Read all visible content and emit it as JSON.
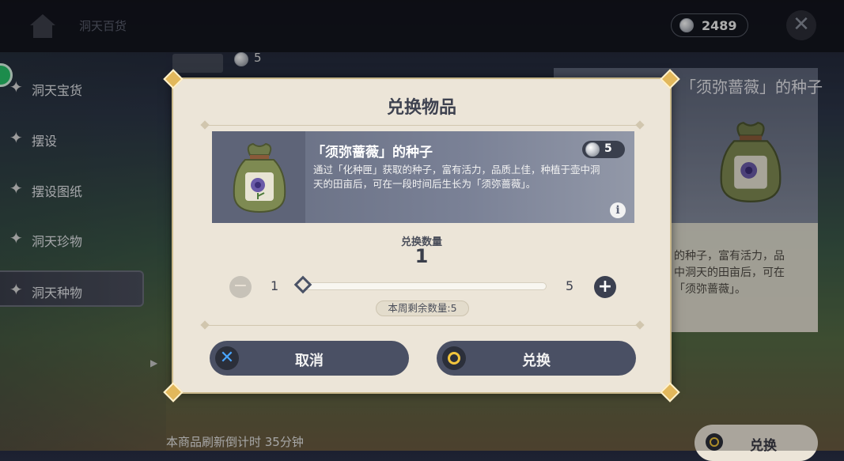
{
  "topbar": {
    "title": "洞天百货",
    "currency_value": "2489",
    "coin_icon": "mora-coin-icon",
    "close_icon": "close-icon"
  },
  "sidebar": {
    "items": [
      {
        "label": "洞天宝货",
        "active": false
      },
      {
        "label": "摆设",
        "active": false
      },
      {
        "label": "摆设图纸",
        "active": false
      },
      {
        "label": "洞天珍物",
        "active": false
      },
      {
        "label": "洞天种物",
        "active": true
      }
    ]
  },
  "background": {
    "list_item_price": "5",
    "detail_title": "「须弥蔷薇」的种子",
    "detail_desc": "的种子，富有活力，品\n中洞天的田亩后，可在\n「须弥蔷薇」。",
    "refresh_text": "本商品刷新倒计时 35分钟",
    "exchange_label": "兑换"
  },
  "dialog": {
    "title": "兑换物品",
    "item": {
      "name": "「须弥蔷薇」的种子",
      "price": "5",
      "description": "通过「化种匣」获取的种子，富有活力，品质上佳，种植于壶中洞天的田亩后，可在一段时间后生长为「须弥蔷薇」。",
      "icon": "rose-seed-bag-icon"
    },
    "quantity": {
      "label": "兑换数量",
      "value": "1",
      "min": "1",
      "max": "5",
      "slider_fraction": 0.0,
      "remaining": "本周剩余数量:5"
    },
    "cancel_label": "取消",
    "confirm_label": "兑换"
  },
  "colors": {
    "dialog_bg": "#ece5d8",
    "button_bg": "#4a5064",
    "accent_gold": "#f2c53d",
    "cancel_blue": "#4aa6ff"
  }
}
